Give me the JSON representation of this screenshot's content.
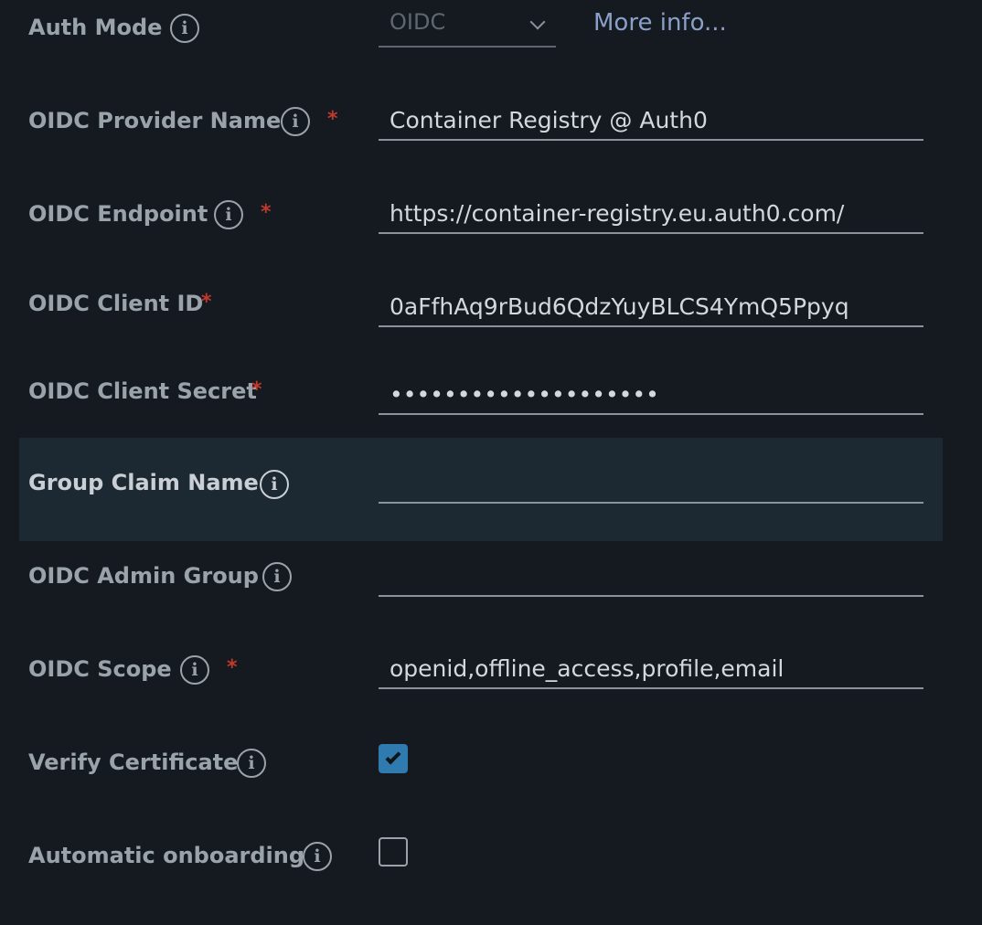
{
  "auth_mode": {
    "label": "Auth Mode",
    "info_icon": "info-icon",
    "selected": "OIDC",
    "dropdown_icon": "chevron-down-icon",
    "more_info_link": "More info..."
  },
  "fields": {
    "provider_name": {
      "label": "OIDC Provider Name",
      "required_mark": "*",
      "value": "Container Registry @ Auth0"
    },
    "endpoint": {
      "label": "OIDC Endpoint",
      "required_mark": "*",
      "value": "https://container-registry.eu.auth0.com/"
    },
    "client_id": {
      "label": "OIDC Client ID",
      "required_mark": "*",
      "value": "0aFfhAq9rBud6QdzYuyBLCS4YmQ5Ppyq"
    },
    "client_secret": {
      "label": "OIDC Client Secret",
      "required_mark": "*",
      "value": "••••••••••••••••••••"
    },
    "group_claim_name": {
      "label": "Group Claim Name",
      "value": ""
    },
    "admin_group": {
      "label": "OIDC Admin Group",
      "value": ""
    },
    "scope": {
      "label": "OIDC Scope",
      "required_mark": "*",
      "value": "openid,offline_access,profile,email"
    },
    "verify_certificate": {
      "label": "Verify Certificate",
      "checked": true
    },
    "automatic_onboarding": {
      "label": "Automatic onboarding",
      "checked": false
    }
  },
  "colors": {
    "background": "#141a20",
    "highlight_row": "#1c2932",
    "label": "#9ba3aa",
    "link": "#8aa0c8",
    "required": "#c0392b",
    "checkbox_checked": "#2f7bb0"
  }
}
